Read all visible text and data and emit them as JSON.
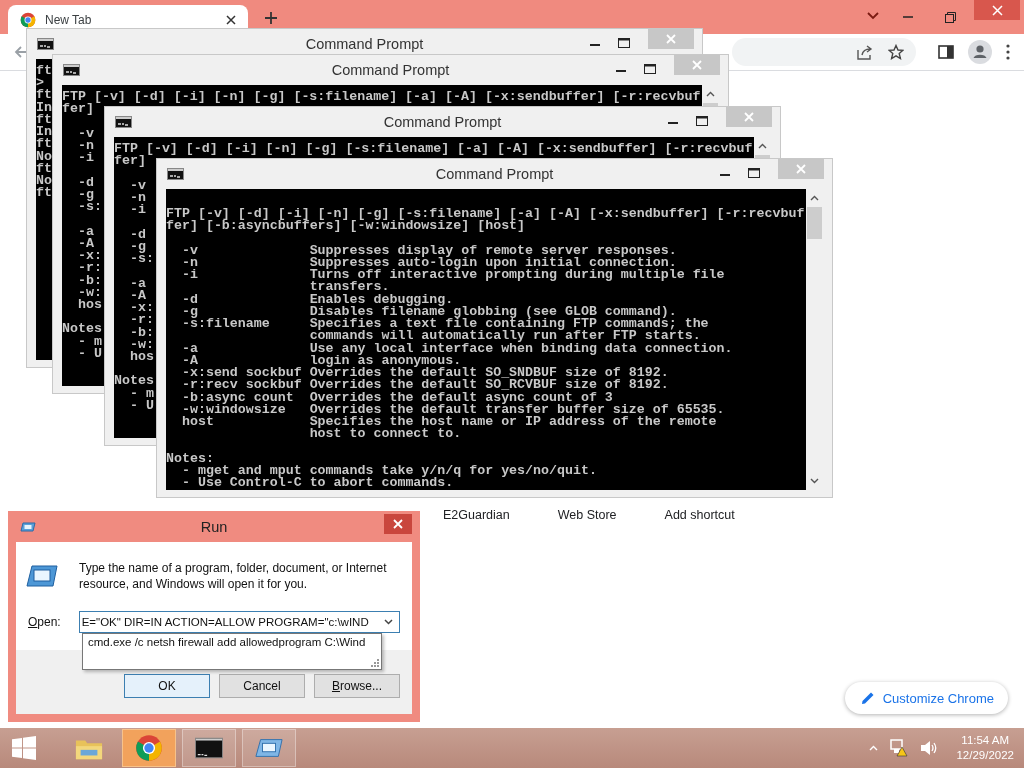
{
  "browser": {
    "tab": {
      "title": "New Tab"
    },
    "shortcuts": [
      {
        "label": "E2Guardian"
      },
      {
        "label": "Web Store"
      },
      {
        "label": "Add shortcut"
      }
    ],
    "customize_button": "Customize Chrome"
  },
  "console_windows": [
    {
      "title": "Command Prompt",
      "blocks": [
        [
          "ft",
          ">",
          "ft",
          "In",
          "ft",
          "In",
          "ft",
          "No",
          "ft",
          "No",
          "ft"
        ]
      ]
    },
    {
      "title": "Command Prompt",
      "blocks": [
        [
          "FTP [-v] [-d] [-i] [-n] [-g] [-s:filename] [-a] [-A] [-x:sendbuffer] [-r:recvbuf",
          "fer]"
        ],
        [
          "  -v",
          "  -n",
          "  -i"
        ],
        [
          "  -d",
          "  -g",
          "  -s:"
        ],
        [
          "  -a",
          "  -A",
          "  -x:",
          "  -r:",
          "  -b:",
          "  -w:",
          "  hos"
        ],
        [
          "Notes",
          "  - m",
          "  - U"
        ]
      ]
    },
    {
      "title": "Command Prompt",
      "blocks": [
        [
          "FTP [-v] [-d] [-i] [-n] [-g] [-s:filename] [-a] [-A] [-x:sendbuffer] [-r:recvbuf",
          "fer]"
        ],
        [
          "  -v",
          "  -n",
          "  -i"
        ],
        [
          "  -d",
          "  -g",
          "  -s:"
        ],
        [
          "  -a",
          "  -A",
          "  -x:",
          "  -r:",
          "  -b:",
          "  -w:",
          "  hos"
        ],
        [
          "Notes",
          "  - m",
          "  - U"
        ]
      ]
    },
    {
      "title": "Command Prompt",
      "blocks": [
        [
          "FTP [-v] [-d] [-i] [-n] [-g] [-s:filename] [-a] [-A] [-x:sendbuffer] [-r:recvbuf",
          "fer] [-b:asyncbuffers] [-w:windowsize] [host]"
        ],
        [
          "  -v              Suppresses display of remote server responses.",
          "  -n              Suppresses auto-login upon initial connection.",
          "  -i              Turns off interactive prompting during multiple file",
          "                  transfers.",
          "  -d              Enables debugging.",
          "  -g              Disables filename globbing (see GLOB command).",
          "  -s:filename     Specifies a text file containing FTP commands; the",
          "                  commands will automatically run after FTP starts.",
          "  -a              Use any local interface when binding data connection.",
          "  -A              login as anonymous.",
          "  -x:send sockbuf Overrides the default SO_SNDBUF size of 8192.",
          "  -r:recv sockbuf Overrides the default SO_RCVBUF size of 8192.",
          "  -b:async count  Overrides the default async count of 3",
          "  -w:windowsize   Overrides the default transfer buffer size of 65535.",
          "  host            Specifies the host name or IP address of the remote",
          "                  host to connect to."
        ],
        [
          "Notes:",
          "  - mget and mput commands take y/n/q for yes/no/quit.",
          "  - Use Control-C to abort commands."
        ]
      ]
    }
  ],
  "run_dialog": {
    "title": "Run",
    "description": "Type the name of a program, folder, document, or Internet resource, and Windows will open it for you.",
    "open_label": {
      "text": "Open:",
      "mnemonic": true
    },
    "open_value": "E=\"OK\" DIR=IN ACTION=ALLOW PROGRAM=\"c:\\wIND",
    "suggestion": "cmd.exe /c netsh firewall add allowedprogram C:\\Wind",
    "buttons": [
      {
        "label": "OK",
        "default": true,
        "mnemonic": false
      },
      {
        "label": "Cancel",
        "default": false,
        "mnemonic": false
      },
      {
        "label": "Browse...",
        "default": false,
        "mnemonic": true
      }
    ]
  },
  "taskbar": {
    "items": [
      {
        "kind": "explorer",
        "open": false,
        "selected": false
      },
      {
        "kind": "chrome",
        "open": true,
        "selected": true
      },
      {
        "kind": "console",
        "open": true,
        "selected": false
      },
      {
        "kind": "run",
        "open": true,
        "selected": false
      }
    ],
    "time": "11:54 AM",
    "date": "12/29/2022"
  }
}
